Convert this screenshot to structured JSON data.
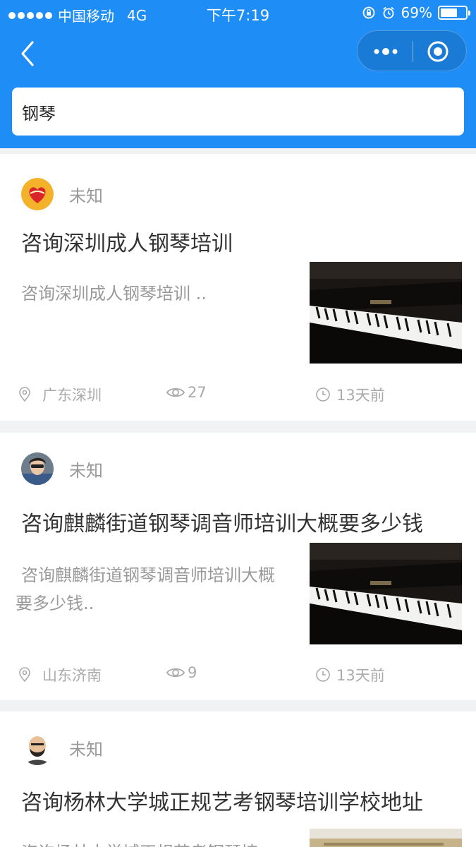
{
  "status_bar": {
    "carrier": "中国移动",
    "network": "4G",
    "time": "下午7:19",
    "battery": "69%",
    "battery_level": 0.69
  },
  "nav": {
    "back_icon": "chevron-left-icon",
    "more_icon": "more-dots-icon",
    "close_icon": "target-circle-icon"
  },
  "search": {
    "value": "钢琴"
  },
  "colors": {
    "primary": "#1e8df5",
    "background": "#f1f2f4",
    "text_main": "#333333",
    "text_muted": "#999999"
  },
  "cards": [
    {
      "author": "未知",
      "title": "咨询深圳成人钢琴培训",
      "desc": "咨询深圳成人钢琴培训 ..",
      "location": "广东深圳",
      "views": "27",
      "time": "13天前"
    },
    {
      "author": "未知",
      "title": "咨询麒麟街道钢琴调音师培训大概要多少钱",
      "desc": "咨询麒麟街道钢琴调音师培训大概要多少钱..",
      "location": "山东济南",
      "views": "9",
      "time": "13天前"
    },
    {
      "author": "未知",
      "title": "咨询杨林大学城正规艺考钢琴培训学校地址",
      "desc": "咨询杨林大学城正规艺考钢琴培"
    }
  ]
}
